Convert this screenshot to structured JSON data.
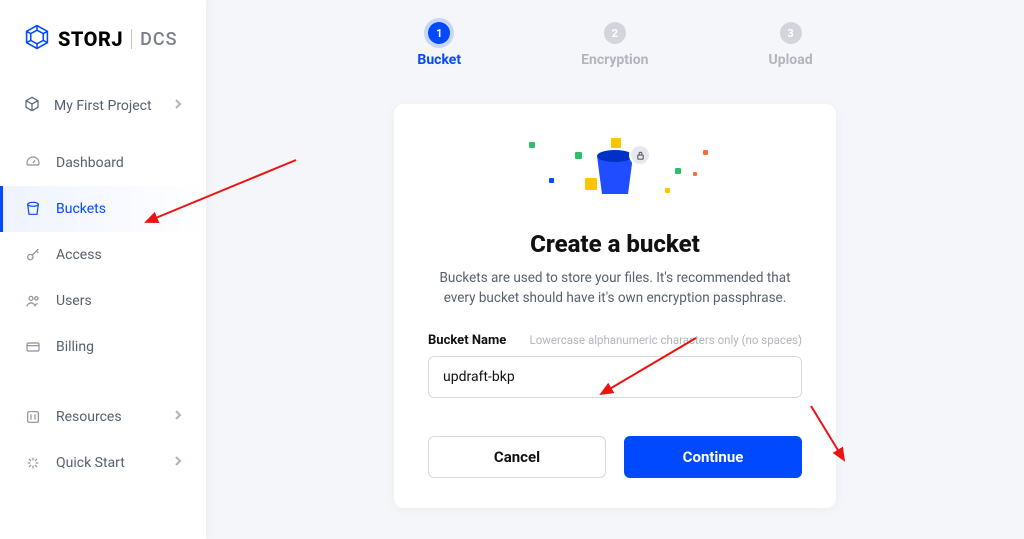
{
  "brand": {
    "name": "STORJ",
    "sub": "DCS"
  },
  "project": {
    "label": "My First Project"
  },
  "nav": {
    "dashboard": "Dashboard",
    "buckets": "Buckets",
    "access": "Access",
    "users": "Users",
    "billing": "Billing",
    "resources": "Resources",
    "quick_start": "Quick Start"
  },
  "stepper": {
    "step1": {
      "num": "1",
      "label": "Bucket"
    },
    "step2": {
      "num": "2",
      "label": "Encryption"
    },
    "step3": {
      "num": "3",
      "label": "Upload"
    }
  },
  "card": {
    "title": "Create a bucket",
    "subtitle": "Buckets are used to store your files. It's recommended that every bucket should have it's own encryption passphrase.",
    "field_label": "Bucket Name",
    "field_hint": "Lowercase alphanumeric characters only (no spaces)",
    "field_value": "updraft-bkp",
    "cancel": "Cancel",
    "continue": "Continue"
  },
  "colors": {
    "primary": "#0149ff"
  }
}
